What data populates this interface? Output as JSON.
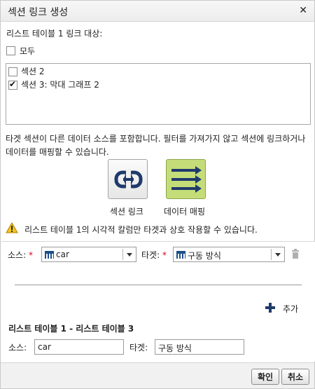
{
  "dialog": {
    "title": "섹션 링크 생성",
    "close_symbol": "✕"
  },
  "target_section": {
    "label": "리스트 테이블 1 링크 대상:",
    "all_label": "모두",
    "all_checked": false,
    "items": [
      {
        "label": "섹션 2",
        "checked": false
      },
      {
        "label": "섹션 3: 막대 그래프 2",
        "checked": true
      }
    ]
  },
  "description": "타겟 섹션이 다른 데이터 소스를 포함합니다. 필터를 가져가지 않고 섹션에 링크하거나 데이터를 매핑할 수 있습니다.",
  "options": {
    "link_label": "섹션 링크",
    "link_icon": "chain-link-icon",
    "map_label": "데이터 매핑",
    "map_icon": "arrows-right-icon",
    "map_selected": true
  },
  "warning": {
    "icon": "warning-triangle-icon",
    "text": "리스트 테이블 1의 시각적 칼럼만 타겟과 상호 작용할 수 있습니다."
  },
  "mapping": {
    "source_label": "소스:",
    "required_mark": "*",
    "source_value": "car",
    "target_label": "타겟:",
    "target_value": "구동 방식",
    "delete_icon": "trash-icon",
    "add_label": "추가",
    "add_icon": "plus-icon"
  },
  "summary": {
    "heading": "리스트 테이블 1 - 리스트 테이블 3",
    "source_label": "소스:",
    "source_value": "car",
    "target_label": "타겟:",
    "target_value": "구동 방식"
  },
  "footer": {
    "ok_label": "확인",
    "cancel_label": "취소"
  },
  "colors": {
    "accent": "#1f3a6b",
    "map_tile": "#c5dd79",
    "required": "#d0021b",
    "warning": "#f0b400",
    "data_icon": "#1b4f8a"
  }
}
